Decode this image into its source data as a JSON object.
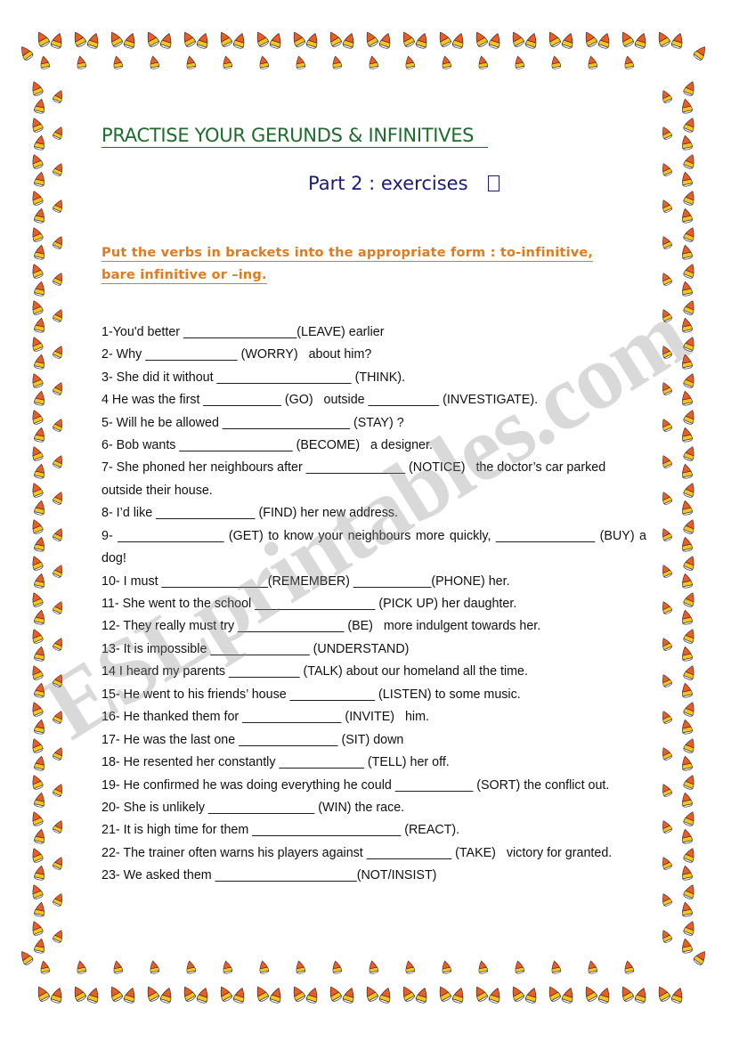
{
  "document": {
    "title": "PRACTISE YOUR GERUNDS & INFINITIVES",
    "subtitle": "Part 2 : exercises",
    "subtitle_symbol": "box-glyph",
    "instructions": "Put the verbs in brackets into the appropriate form : to-infinitive, bare infinitive or –ing.",
    "watermark": "ESLprintables.com"
  },
  "colors": {
    "title": "#1f6b2e",
    "subtitle": "#1b1b7a",
    "instructions": "#e07b1e",
    "body": "#111111",
    "candy_orange": "#f15a22",
    "candy_yellow": "#fbc21b",
    "candy_white": "#ffffff",
    "watermark": "#8c8c8c"
  },
  "exercises": [
    "1-You'd better ________________(LEAVE) earlier",
    "2- Why _____________ (WORRY)   about him?",
    "3- She did it without ___________________ (THINK).",
    "4 He was the first ___________ (GO)   outside __________ (INVESTIGATE).",
    "5- Will he be allowed __________________ (STAY) ?",
    "6- Bob wants ________________ (BECOME)   a designer.",
    "7- She phoned her neighbours after ______________ (NOTICE)   the doctor’s car parked outside their house.",
    "8- I’d like ______________ (FIND) her new address.",
    "9-   _______________   (GET)   to   know   your   neighbours   more   quickly, ______________ (BUY) a dog!",
    "10- I must _______________(REMEMBER) ___________(PHONE) her.",
    "11- She went to the school _________________ (PICK UP) her daughter.",
    "12- They really must try _______________ (BE)   more indulgent towards her.",
    "13- It is impossible ______________ (UNDERSTAND)",
    "14 I heard my parents __________ (TALK) about our homeland all the time.",
    "15- He went to his friends’ house ____________ (LISTEN) to some music.",
    "16- He thanked them for ______________ (INVITE)   him.",
    "17- He was the last one ______________ (SIT) down",
    "18- He resented her constantly ____________ (TELL) her off.",
    "19- He confirmed he was doing everything he could ___________ (SORT) the conflict out.",
    "20- She is unlikely _______________ (WIN) the race.",
    "21- It is high time for them _____________________ (REACT).",
    "22- The trainer often warns his players against ____________ (TAKE)   victory for granted.",
    "23- We asked them ____________________(NOT/INSIST)"
  ],
  "border": {
    "motif": "candy-corn",
    "top_rows": 2,
    "bottom_rows": 2,
    "side_columns": 2
  }
}
